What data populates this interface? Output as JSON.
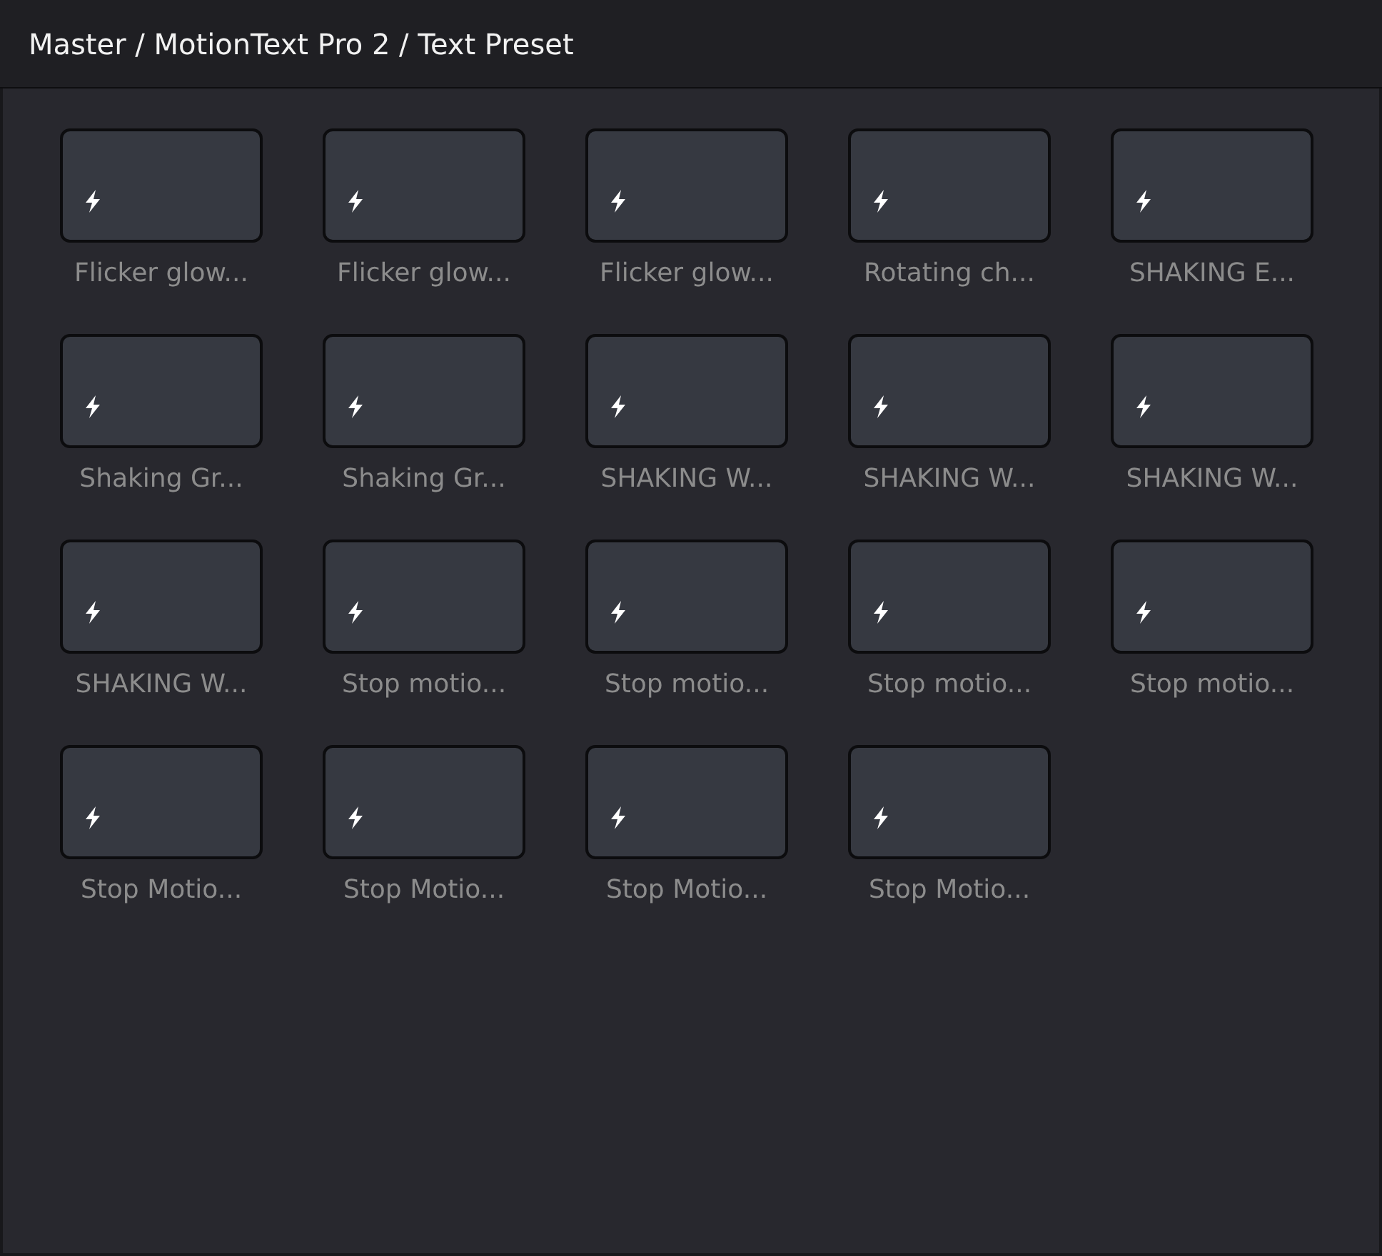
{
  "breadcrumb": "Master / MotionText Pro 2 / Text Preset",
  "presets": [
    {
      "label": "Flicker glow..."
    },
    {
      "label": "Flicker glow..."
    },
    {
      "label": "Flicker glow..."
    },
    {
      "label": "Rotating ch..."
    },
    {
      "label": "SHAKING E..."
    },
    {
      "label": "Shaking Gr..."
    },
    {
      "label": "Shaking Gr..."
    },
    {
      "label": "SHAKING W..."
    },
    {
      "label": "SHAKING W..."
    },
    {
      "label": "SHAKING W..."
    },
    {
      "label": "SHAKING W..."
    },
    {
      "label": "Stop motio..."
    },
    {
      "label": "Stop motio..."
    },
    {
      "label": "Stop motio..."
    },
    {
      "label": "Stop motio..."
    },
    {
      "label": "Stop Motio..."
    },
    {
      "label": "Stop Motio..."
    },
    {
      "label": "Stop Motio..."
    },
    {
      "label": "Stop Motio..."
    }
  ]
}
